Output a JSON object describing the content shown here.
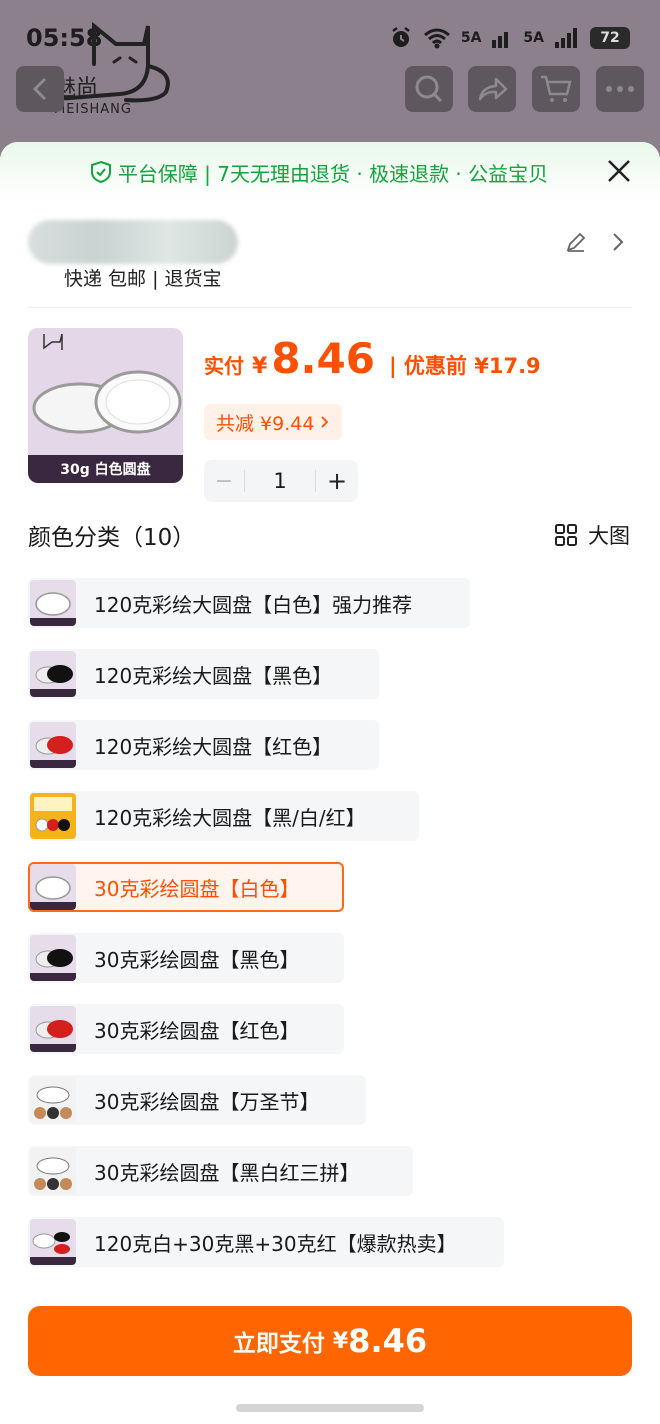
{
  "status_bar": {
    "time": "05:58",
    "signal1": "5A",
    "signal2": "5A",
    "battery": "72"
  },
  "brand": {
    "name": "魅尚",
    "sub": "MEISHANG"
  },
  "guarantee": {
    "text": "平台保障 | 7天无理由退货 · 极速退款 · 公益宝贝"
  },
  "address": {
    "delivery": "快递 包邮 | 退货宝"
  },
  "product": {
    "image_caption": "30g  白色圆盘",
    "paid_label": "实付",
    "currency": "¥",
    "price": "8.46",
    "original_label": "| 优惠前 ¥17.9",
    "discount_chip": "共减 ¥9.44",
    "quantity": "1"
  },
  "options_section": {
    "title": "颜色分类（10）",
    "big_image_label": "大图"
  },
  "options": [
    {
      "label": "120克彩绘大圆盘【白色】强力推荐",
      "selected": false,
      "thumb": "white"
    },
    {
      "label": "120克彩绘大圆盘【黑色】",
      "selected": false,
      "thumb": "black"
    },
    {
      "label": "120克彩绘大圆盘【红色】",
      "selected": false,
      "thumb": "red"
    },
    {
      "label": "120克彩绘大圆盘【黑/白/红】",
      "selected": false,
      "thumb": "combo"
    },
    {
      "label": "30克彩绘圆盘【白色】",
      "selected": true,
      "thumb": "white"
    },
    {
      "label": "30克彩绘圆盘【黑色】",
      "selected": false,
      "thumb": "black"
    },
    {
      "label": "30克彩绘圆盘【红色】",
      "selected": false,
      "thumb": "red"
    },
    {
      "label": "30克彩绘圆盘【万圣节】",
      "selected": false,
      "thumb": "halloween"
    },
    {
      "label": "30克彩绘圆盘【黑白红三拼】",
      "selected": false,
      "thumb": "halloween"
    },
    {
      "label": "120克白+30克黑+30克红【爆款热卖】",
      "selected": false,
      "thumb": "bundle"
    }
  ],
  "pay_button": {
    "label": "立即支付",
    "currency": "¥",
    "amount": "8.46"
  },
  "colors": {
    "accent": "#ff5000",
    "button": "#ff6500",
    "guarantee_green": "#14a33c"
  }
}
